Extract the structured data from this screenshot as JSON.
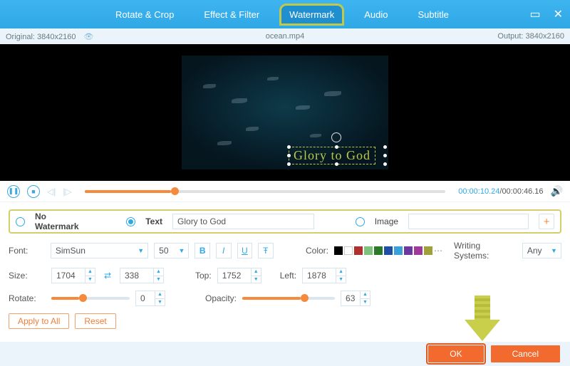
{
  "tabs": [
    "Rotate & Crop",
    "Effect & Filter",
    "Watermark",
    "Audio",
    "Subtitle"
  ],
  "active_tab_index": 2,
  "infobar": {
    "originalLabel": "Original:",
    "originalRes": "3840x2160",
    "filename": "ocean.mp4",
    "outputLabel": "Output:",
    "outputRes": "3840x2160"
  },
  "watermark_overlay": {
    "text": "Glory to God"
  },
  "playback": {
    "current": "00:00:10.24",
    "total": "00:00:46.16",
    "progress_pct": 24
  },
  "wm_options": {
    "none_label": "No Watermark",
    "text_label": "Text",
    "image_label": "Image",
    "text_value": "Glory to God",
    "image_value": "",
    "selected": "text"
  },
  "font": {
    "label": "Font:",
    "family": "SimSun",
    "size": "50",
    "colorLabel": "Color:",
    "writingLabel": "Writing Systems:",
    "writingValue": "Any",
    "swatches": [
      "#000000",
      "#ffffff",
      "#b03030",
      "#7fc27f",
      "#2a7a2a",
      "#1e4fa0",
      "#3aa0d8",
      "#6a3aa0",
      "#a03a9a",
      "#a0a03a"
    ]
  },
  "size": {
    "label": "Size:",
    "w": "1704",
    "h": "338",
    "topLabel": "Top:",
    "top": "1752",
    "leftLabel": "Left:",
    "left": "1878"
  },
  "rotate": {
    "label": "Rotate:",
    "value": "0",
    "pct": 35
  },
  "opacity": {
    "label": "Opacity:",
    "value": "63",
    "pct": 63
  },
  "buttons": {
    "apply": "Apply to All",
    "reset": "Reset",
    "ok": "OK",
    "cancel": "Cancel"
  }
}
